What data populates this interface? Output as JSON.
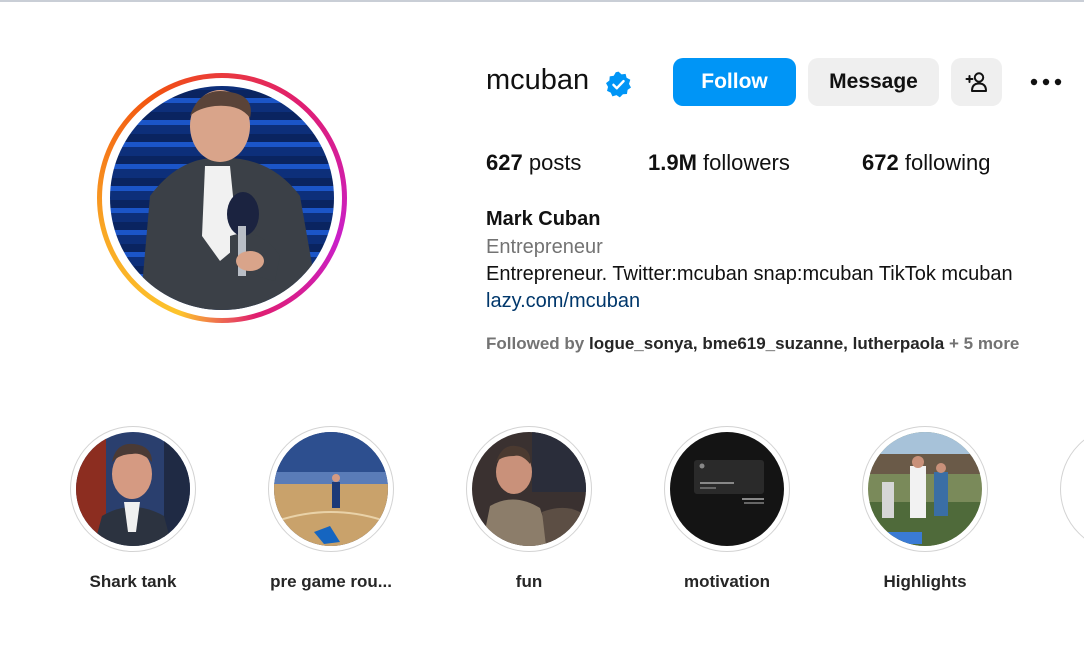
{
  "profile": {
    "username": "mcuban",
    "full_name": "Mark Cuban",
    "category": "Entrepreneur",
    "bio": "Entrepreneur. Twitter:mcuban snap:mcuban TikTok mcuban",
    "link": "lazy.com/mcuban",
    "verified_icon": "verified-badge-icon"
  },
  "actions": {
    "follow_label": "Follow",
    "message_label": "Message",
    "add_user_icon": "add-user-icon",
    "more_icon": "more-options-icon"
  },
  "stats": {
    "posts_count": "627",
    "posts_label": "posts",
    "followers_count": "1.9M",
    "followers_label": "followers",
    "following_count": "672",
    "following_label": "following"
  },
  "followed_by": {
    "prefix": "Followed by",
    "users": [
      "logue_sonya",
      "bme619_suzanne",
      "lutherpaola"
    ],
    "more": "+ 5 more"
  },
  "highlights": [
    {
      "label": "Shark tank"
    },
    {
      "label": "pre game rou..."
    },
    {
      "label": "fun"
    },
    {
      "label": "motivation"
    },
    {
      "label": "Highlights"
    }
  ],
  "colors": {
    "follow_button": "#0095f6",
    "secondary_button": "#efefef",
    "link": "#00376b",
    "muted_text": "#737373"
  }
}
